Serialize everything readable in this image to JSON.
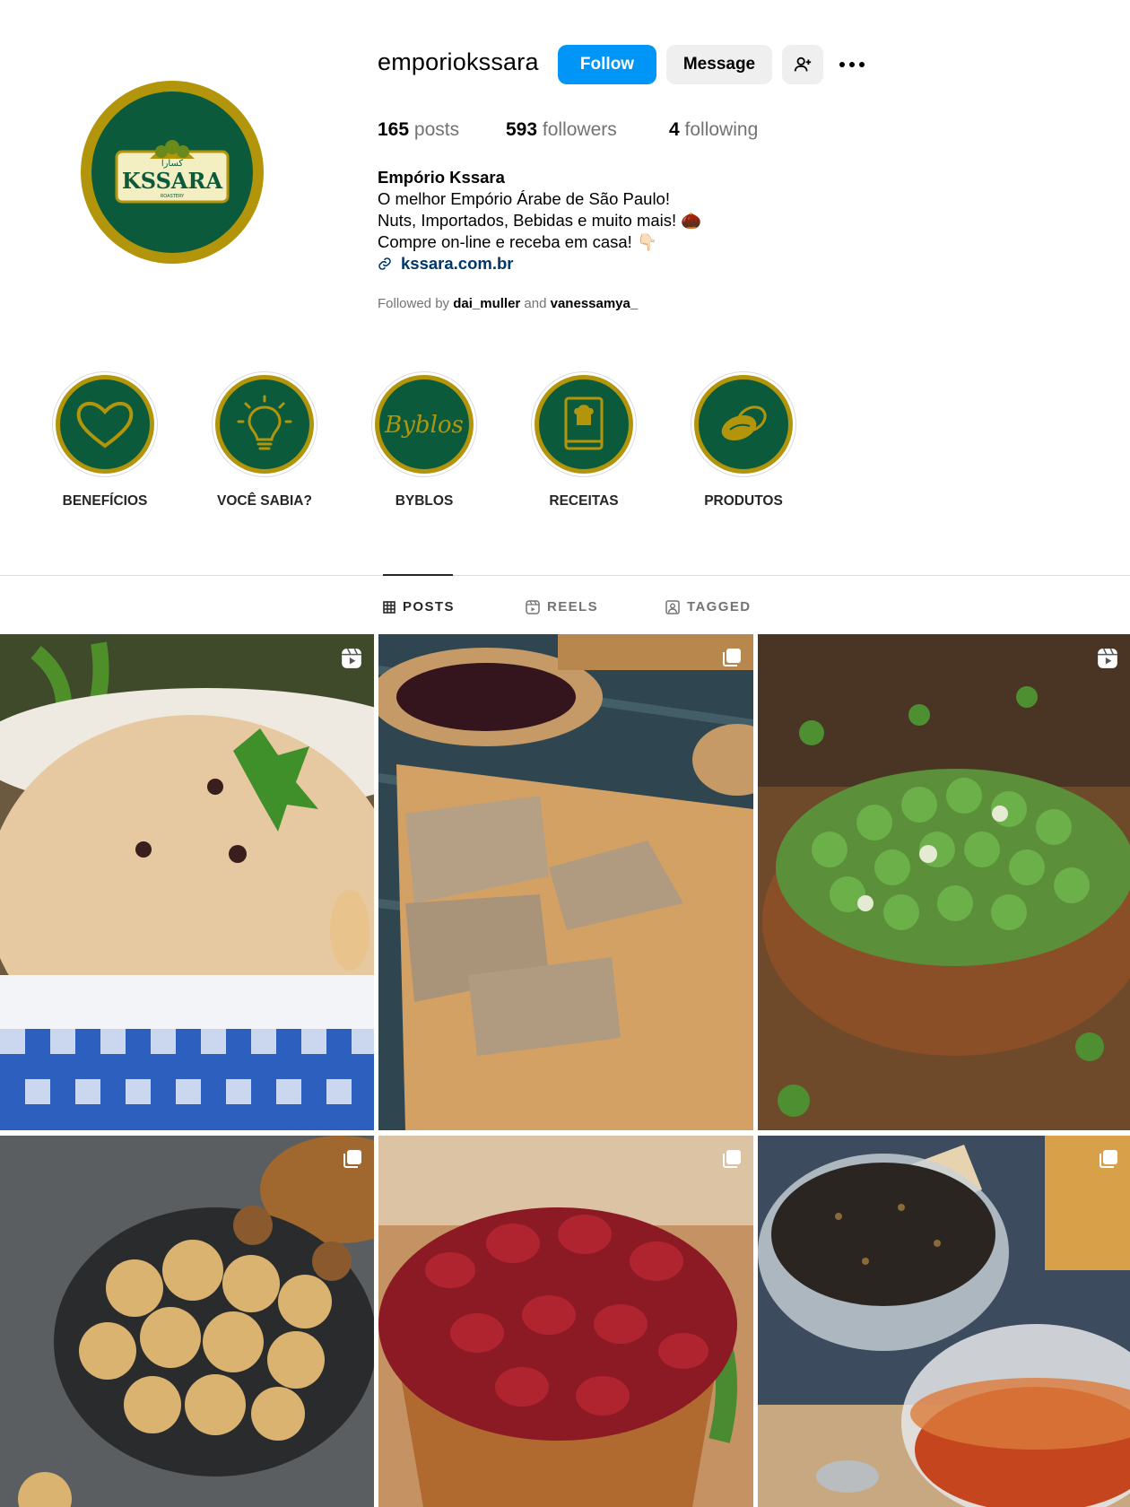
{
  "profile": {
    "username": "emporiokssara",
    "follow_label": "Follow",
    "message_label": "Message",
    "avatar_text": "KSSARA",
    "avatar_sub": "ROASTERY",
    "avatar_arabic": "كسارا"
  },
  "stats": [
    {
      "count": "165",
      "label": "posts"
    },
    {
      "count": "593",
      "label": "followers"
    },
    {
      "count": "4",
      "label": "following"
    }
  ],
  "bio": {
    "name": "Empório Kssara",
    "line1": "O melhor Empório Árabe de São Paulo!",
    "line2": "Nuts, Importados, Bebidas e muito mais! 🌰",
    "line3": "Compre on-line e receba em casa! 👇🏻",
    "link": "kssara.com.br"
  },
  "followed_by": {
    "prefix": "Followed by",
    "user1": "dai_muller",
    "and": "and",
    "user2": "vanessamya_"
  },
  "highlights": [
    {
      "label": "BENEFÍCIOS",
      "icon": "heart-icon"
    },
    {
      "label": "VOCÊ SABIA?",
      "icon": "lightbulb-icon"
    },
    {
      "label": "BYBLOS",
      "icon": "byblos-script",
      "text": "Byblos"
    },
    {
      "label": "RECEITAS",
      "icon": "recipe-book-icon"
    },
    {
      "label": "PRODUTOS",
      "icon": "nuts-icon"
    }
  ],
  "tabs": [
    {
      "label": "POSTS",
      "icon": "grid-icon",
      "active": true
    },
    {
      "label": "REELS",
      "icon": "reels-icon",
      "active": false
    },
    {
      "label": "TAGGED",
      "icon": "tagged-icon",
      "active": false
    }
  ],
  "posts": [
    {
      "subject": "rice-pilaf",
      "type": "reel"
    },
    {
      "subject": "halva",
      "type": "carousel"
    },
    {
      "subject": "wasabi-peas",
      "type": "reel"
    },
    {
      "subject": "dried-figs",
      "type": "carousel"
    },
    {
      "subject": "dried-cranberries",
      "type": "carousel"
    },
    {
      "subject": "tea",
      "type": "carousel"
    }
  ],
  "colors": {
    "brand_green": "#0b5a3c",
    "brand_gold": "#b3950c",
    "follow_blue": "#0095f6",
    "link_blue": "#00376b"
  }
}
